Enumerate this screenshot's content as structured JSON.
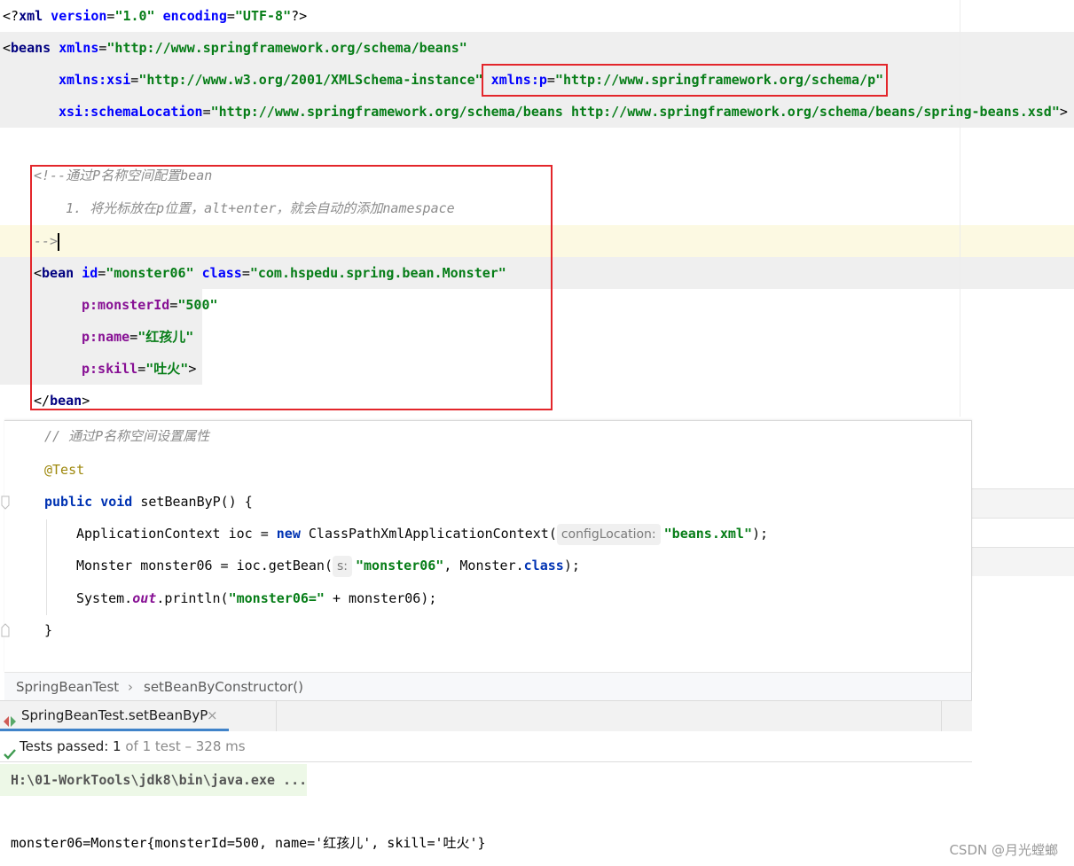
{
  "xml_editor": {
    "line1": {
      "open": "<?",
      "tag": "xml",
      "a1": " version",
      "eq1": "=",
      "v1": "\"1.0\"",
      "a2": " encoding",
      "eq2": "=",
      "v2": "\"UTF-8\"",
      "close": "?>"
    },
    "line2": {
      "open": "<",
      "tag": "beans",
      "a1": " xmlns",
      "eq1": "=",
      "v1": "\"http://www.springframework.org/schema/beans\""
    },
    "line3": {
      "a1": "xmlns:xsi",
      "eq1": "=",
      "v1": "\"http://www.w3.org/2001/XMLSchema-instance\"",
      "a2": "xmlns:p",
      "eq2": "=",
      "v2": "\"http://www.springframework.org/schema/p\""
    },
    "line4": {
      "a1": "xsi:schemaLocation",
      "eq1": "=",
      "v1": "\"http://www.springframework.org/schema/beans http://www.springframework.org/schema/beans/spring-beans.xsd\"",
      "close": ">"
    },
    "comment1": "<!--通过P名称空间配置bean",
    "comment2": "1. 将光标放在p位置，alt+enter，就会自动的添加namespace",
    "comment3": "-->",
    "bean_line": {
      "open": "<",
      "tag": "bean",
      "a1": " id",
      "eq1": "=",
      "v1": "\"monster06\"",
      "a2": " class",
      "eq2": "=",
      "v2": "\"com.hspedu.spring.bean.Monster\""
    },
    "p1": {
      "attr": "p:monsterId",
      "eq": "=",
      "val": "\"500\""
    },
    "p2": {
      "attr": "p:name",
      "eq": "=",
      "val": "\"红孩儿\""
    },
    "p3": {
      "attr": "p:skill",
      "eq": "=",
      "val": "\"吐火\"",
      "close": ">"
    },
    "bean_close": {
      "open": "</",
      "tag": "bean",
      "close": ">"
    }
  },
  "java_editor": {
    "comment": "// 通过P名称空间设置属性",
    "annotation": "@Test",
    "sig": {
      "kw1": "public",
      "kw2": "void",
      "name": " setBeanByP() {"
    },
    "l1": {
      "pre": "ApplicationContext ioc = ",
      "kw": "new",
      "cls": " ClassPathXmlApplicationContext(",
      "hint": "configLocation:",
      "str": "\"beans.xml\"",
      "post": ");"
    },
    "l2": {
      "pre": "Monster monster06 = ioc.getBean(",
      "hint": "s:",
      "str": "\"monster06\"",
      "mid": ", Monster.",
      "kw": "class",
      "post": ");"
    },
    "l3": {
      "pre": "System.",
      "static": "out",
      "mid": ".println(",
      "str": "\"monster06=\"",
      "post": " + monster06);"
    },
    "close": "}"
  },
  "breadcrumb": {
    "class": "SpringBeanTest",
    "sep": "›",
    "method": "setBeanByConstructor()"
  },
  "run": {
    "tab_label": "SpringBeanTest.setBeanByP",
    "tab_close": "×",
    "status_prefix": "Tests passed:",
    "status_count": " 1",
    "status_detail": " of 1 test – 328 ms",
    "cmd": "H:\\01-WorkTools\\jdk8\\bin\\java.exe ...",
    "output": "monster06=Monster{monsterId=500, name='红孩儿', skill='吐火'}"
  },
  "watermark": "CSDN @月光螳螂"
}
